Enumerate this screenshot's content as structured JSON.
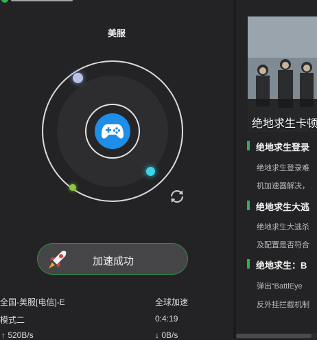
{
  "server": {
    "name": "美服"
  },
  "button": {
    "label": "加速成功"
  },
  "stats": {
    "route": "全国-美服[电信]-E",
    "mode": "模式二",
    "upload": "↑ 520B/s",
    "global_label": "全球加速",
    "timer": "0:4:19",
    "download": "↓ 0B/s"
  },
  "banner": {
    "title": "绝地求生卡顿"
  },
  "news": [
    {
      "title": "绝地求生登录",
      "lines": [
        "绝地求生登录难",
        "机加速器解决，"
      ]
    },
    {
      "title": "绝地求生大逃",
      "lines": [
        "绝地求生大逃杀",
        "及配置是否符合"
      ]
    },
    {
      "title": "绝地求生：B",
      "lines": [
        "弹出“BattlEye",
        "反外挂拦截机制"
      ]
    }
  ],
  "colors": {
    "accent": "#2db34b",
    "gamepad": "#1f8ee8",
    "background": "#232325"
  },
  "icons": [
    "gamepad-icon",
    "refresh-icon",
    "rocket-icon"
  ]
}
